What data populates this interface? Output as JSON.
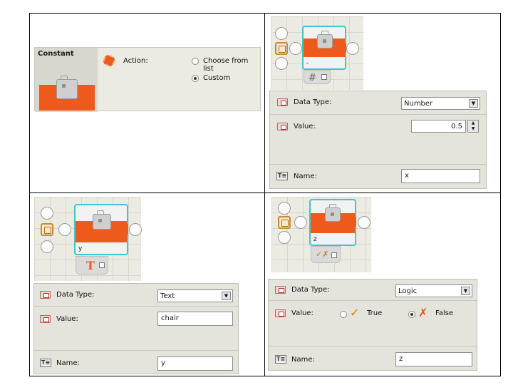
{
  "quadrant1": {
    "title": "Constant",
    "action_label": "Action:",
    "options": [
      "Choose from list",
      "Custom"
    ],
    "selected": "Custom"
  },
  "quadrant2": {
    "block_label": "-",
    "tab_glyph": "#",
    "data_type_label": "Data Type:",
    "data_type_value": "Number",
    "value_label": "Value:",
    "value": "0.5",
    "name_label": "Name:",
    "name": "x"
  },
  "quadrant3": {
    "block_label": "y",
    "tab_glyph": "T",
    "data_type_label": "Data Type:",
    "data_type_value": "Text",
    "value_label": "Value:",
    "value": "chair",
    "name_label": "Name:",
    "name": "y"
  },
  "quadrant4": {
    "block_label": "z",
    "tab_glyph": "✓✗",
    "data_type_label": "Data Type:",
    "data_type_value": "Logic",
    "value_label": "Value:",
    "true_label": "True",
    "false_label": "False",
    "selected": "False",
    "name_label": "Name:",
    "name": "z"
  },
  "icons": {
    "accent": "#ee5a1c",
    "selection": "#3ec7c9"
  }
}
